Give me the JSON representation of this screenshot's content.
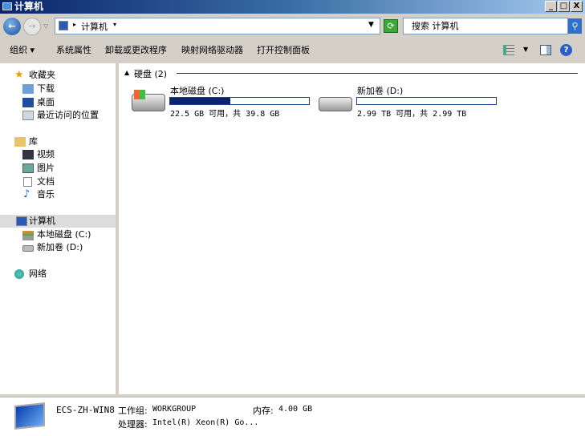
{
  "window": {
    "title": "计算机",
    "minimize": "_",
    "maximize": "□",
    "close": "X"
  },
  "address": {
    "crumb": "计算机",
    "search_placeholder": "搜索 计算机"
  },
  "toolbar": {
    "organize": "组织",
    "system_properties": "系统属性",
    "uninstall": "卸载或更改程序",
    "map_drive": "映射网络驱动器",
    "control_panel": "打开控制面板"
  },
  "sidebar": {
    "favorites": "收藏夹",
    "downloads": "下载",
    "desktop": "桌面",
    "recent": "最近访问的位置",
    "libraries": "库",
    "videos": "视频",
    "pictures": "图片",
    "documents": "文档",
    "music": "音乐",
    "computer": "计算机",
    "drive_c": "本地磁盘 (C:)",
    "drive_d": "新加卷 (D:)",
    "network": "网络"
  },
  "main": {
    "group_title": "硬盘 (2)",
    "drives": [
      {
        "name": "本地磁盘 (C:)",
        "info": "22.5 GB 可用，共 39.8 GB",
        "used_fraction": 0.435
      },
      {
        "name": "新加卷 (D:)",
        "info": "2.99 TB 可用，共 2.99 TB",
        "used_fraction": 0.0
      }
    ]
  },
  "status": {
    "computer_name": "ECS-ZH-WIN8",
    "workgroup_label": "工作组:",
    "workgroup": "WORKGROUP",
    "memory_label": "内存:",
    "memory": "4.00 GB",
    "cpu_label": "处理器:",
    "cpu": "Intel(R) Xeon(R) Go..."
  }
}
